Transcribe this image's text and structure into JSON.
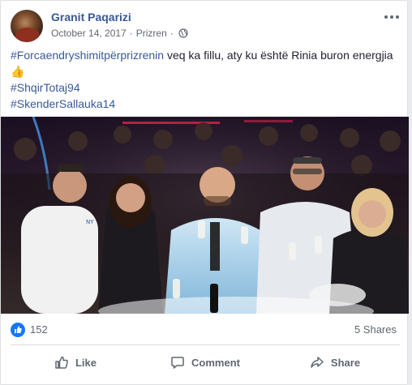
{
  "post": {
    "author": "Granit Paqarizi",
    "date": "October 14, 2017",
    "location": "Prizren",
    "separator": "·",
    "text_line1_hashtag": "#Forcaendryshimitpërprizrenin",
    "text_line1_rest": " veq ka fillu, aty ku është Rinia buron energjia ",
    "text_emoji": "👍",
    "hashtag2": "#ShqirTotaj94",
    "hashtag3": "#SkenderSallauka14"
  },
  "stats": {
    "likes": "152",
    "shares": "5 Shares"
  },
  "actions": {
    "like": "Like",
    "comment": "Comment",
    "share": "Share"
  },
  "icons": [
    "globe-icon",
    "more-icon",
    "like-badge-icon",
    "thumbs-up-icon",
    "comment-icon",
    "share-icon"
  ],
  "colors": {
    "link": "#385898",
    "text": "#1d2129",
    "meta": "#616770",
    "like_blue": "#1877f2"
  }
}
